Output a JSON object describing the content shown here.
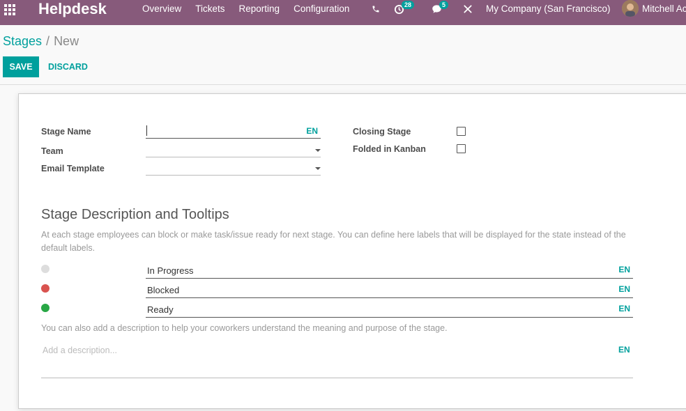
{
  "navbar": {
    "brand": "Helpdesk",
    "menu": [
      "Overview",
      "Tickets",
      "Reporting",
      "Configuration"
    ],
    "activity_count": "28",
    "message_count": "5",
    "company": "My Company (San Francisco)",
    "user": "Mitchell Ac",
    "colors": {
      "bar": "#875a7b",
      "badge": "#00a09d"
    }
  },
  "breadcrumb": {
    "parent": "Stages",
    "separator": "/",
    "current": "New"
  },
  "buttons": {
    "save": "SAVE",
    "discard": "DISCARD"
  },
  "form": {
    "stage_name_label": "Stage Name",
    "stage_name_value": "",
    "team_label": "Team",
    "team_value": "",
    "email_template_label": "Email Template",
    "email_template_value": "",
    "closing_stage_label": "Closing Stage",
    "closing_stage_checked": false,
    "folded_label": "Folded in Kanban",
    "folded_checked": false,
    "lang": "EN"
  },
  "tooltips": {
    "title": "Stage Description and Tooltips",
    "help": "At each stage employees can block or make task/issue ready for next stage. You can define here labels that will be displayed for the state instead of the default labels.",
    "states": [
      {
        "label": "In Progress",
        "color": "#dddddd"
      },
      {
        "label": "Blocked",
        "color": "#d9534f"
      },
      {
        "label": "Ready",
        "color": "#28a745"
      }
    ],
    "description_help": "You can also add a description to help your coworkers understand the meaning and purpose of the stage.",
    "description_placeholder": "Add a description..."
  }
}
